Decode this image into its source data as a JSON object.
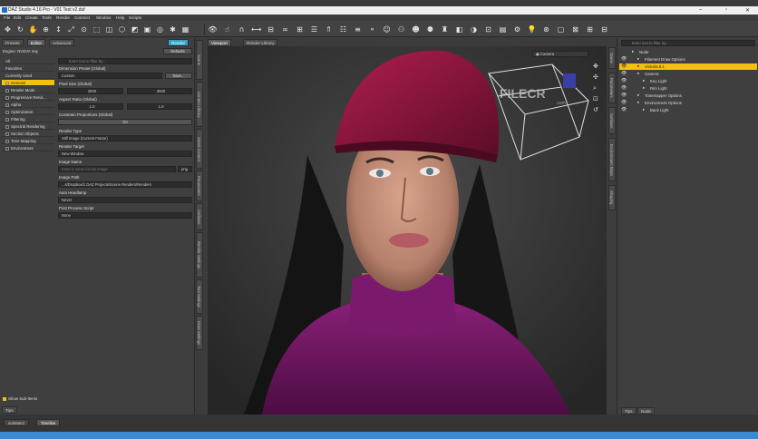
{
  "window": {
    "title": "DAZ Studio 4.16 Pro - V01 Test v2.duf",
    "min": "–",
    "max": "▫",
    "close": "✕"
  },
  "menu": [
    "File",
    "Edit",
    "Create",
    "Tools",
    "Render",
    "Connect",
    "Window",
    "Help",
    "Scripts"
  ],
  "left_panel": {
    "tabs": [
      "Presets",
      "Editor",
      "Advanced"
    ],
    "render_button": "Render",
    "engine_label": "Engine: NVIDIA Iray",
    "defaults_button": "Defaults",
    "search_placeholder": "Enter text to filter by...",
    "categories": [
      {
        "label": "All",
        "box": false
      },
      {
        "label": "Favorites",
        "box": false
      },
      {
        "label": "Currently Used",
        "box": false
      },
      {
        "label": "General",
        "box": true,
        "selected": true
      },
      {
        "label": "Render Mode",
        "box": true
      },
      {
        "label": "Progressive Rend...",
        "box": true
      },
      {
        "label": "Alpha",
        "box": true
      },
      {
        "label": "Optimization",
        "box": true
      },
      {
        "label": "Filtering",
        "box": true
      },
      {
        "label": "Spectral Rendering",
        "box": true
      },
      {
        "label": "Section Objects",
        "box": true
      },
      {
        "label": "Tone Mapping",
        "box": true
      },
      {
        "label": "Environment",
        "box": true
      }
    ],
    "settings": {
      "dimension_preset_label": "Dimension Preset (Global)",
      "dimension_preset_value": "Custom",
      "save_button": "Save...",
      "pixel_size_label": "Pixel Size (Global)",
      "pixel_w": "3000",
      "pixel_h": "3000",
      "aspect_label": "Aspect Ratio (Global)",
      "aspect_w": "1.0",
      "aspect_h": "1.0",
      "constrain_label": "Constrain Proportions (Global)",
      "constrain_value": "On",
      "render_type_label": "Render Type",
      "render_type_value": "Still Image (Current Frame)",
      "render_target_label": "Render Target",
      "render_target_value": "New Window",
      "image_name_label": "Image Name",
      "image_name_placeholder": "Enter a name for the image",
      "image_ext": "png",
      "image_path_label": "Image Path",
      "image_path_value": "...s/Dropbox/1 DAZ Projects/Scene Renders/Renders",
      "auto_headlamp_label": "Auto Headlamp",
      "auto_headlamp_value": "Never",
      "post_process_label": "Post Process Script",
      "post_process_value": "None"
    },
    "show_subitems": "Show Sub-Items",
    "tips_tab": "Tips"
  },
  "left_vtabs": [
    "Scene",
    "Content Library",
    "Smart Content",
    "Parameters",
    "Surfaces",
    "Render Settings",
    "Tool Settings",
    "Draw Settings"
  ],
  "viewport": {
    "tabs": [
      "Viewport",
      "Render Library"
    ],
    "camera_selector": "Camera",
    "watermark": "FILECR",
    "watermark_sub": ".com"
  },
  "right_panel": {
    "search_placeholder": "Enter text to filter by...",
    "scene_items": [
      {
        "label": "Node",
        "indent": 0,
        "eye": false
      },
      {
        "label": "Filament Draw Options",
        "indent": 1,
        "eye": true
      },
      {
        "label": "Victoria 8.1",
        "indent": 1,
        "eye": true,
        "selected": true
      },
      {
        "label": "Camera",
        "indent": 1,
        "eye": true
      },
      {
        "label": "Key Light",
        "indent": 2,
        "eye": true
      },
      {
        "label": "Rim Light",
        "indent": 2,
        "eye": true
      },
      {
        "label": "Tonemapper Options",
        "indent": 1,
        "eye": true
      },
      {
        "label": "Environment Options",
        "indent": 1,
        "eye": true
      },
      {
        "label": "Back Light",
        "indent": 2,
        "eye": true
      }
    ],
    "bottom_tabs": [
      "Tips",
      "Node"
    ]
  },
  "right_vtabs": [
    "Scene",
    "Parameters",
    "Surfaces",
    "Environment Maps",
    "Shaping"
  ],
  "bottom_bar": {
    "tabs": [
      "aniMate2",
      "Timeline"
    ]
  },
  "colors": {
    "selection": "#f2c011",
    "accent": "#35a3c6"
  }
}
